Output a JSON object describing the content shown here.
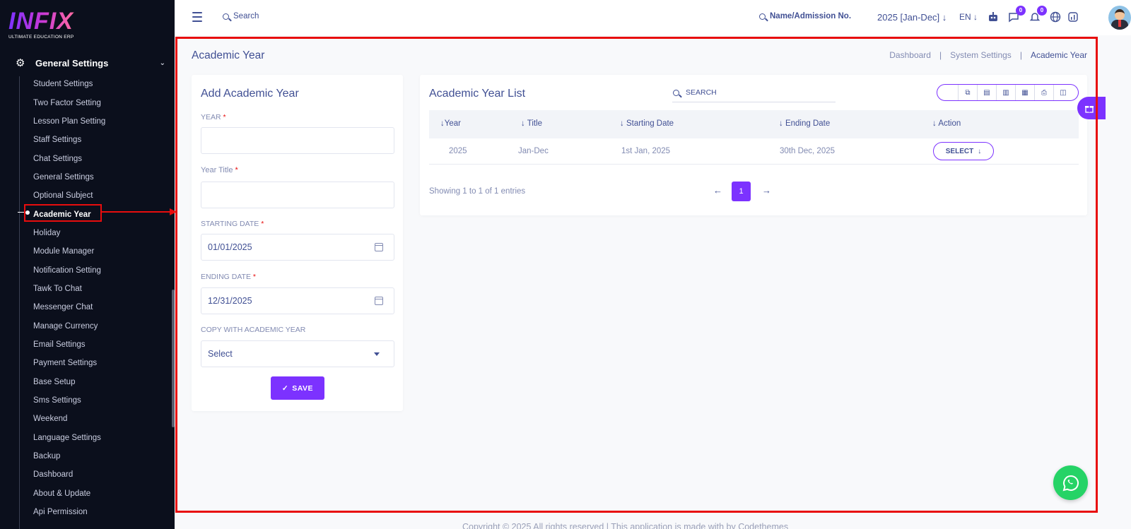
{
  "sidebar": {
    "logo": "INFIX",
    "logo_sub": "ULTIMATE EDUCATION ERP",
    "section_title": "General Settings",
    "items": [
      {
        "label": "Student Settings"
      },
      {
        "label": "Two Factor Setting"
      },
      {
        "label": "Lesson Plan Setting"
      },
      {
        "label": "Staff Settings"
      },
      {
        "label": "Chat Settings"
      },
      {
        "label": "General Settings"
      },
      {
        "label": "Optional Subject"
      },
      {
        "label": "Academic Year"
      },
      {
        "label": "Holiday"
      },
      {
        "label": "Module Manager"
      },
      {
        "label": "Notification Setting"
      },
      {
        "label": "Tawk To Chat"
      },
      {
        "label": "Messenger Chat"
      },
      {
        "label": "Manage Currency"
      },
      {
        "label": "Email Settings"
      },
      {
        "label": "Payment Settings"
      },
      {
        "label": "Base Setup"
      },
      {
        "label": "Sms Settings"
      },
      {
        "label": "Weekend"
      },
      {
        "label": "Language Settings"
      },
      {
        "label": "Backup"
      },
      {
        "label": "Dashboard"
      },
      {
        "label": "About & Update"
      },
      {
        "label": "Api Permission"
      }
    ],
    "active_item": "Academic Year"
  },
  "topbar": {
    "search_label": "Search",
    "name_search_label": "Name/Admission No.",
    "session": "2025 [Jan-Dec]",
    "language": "EN",
    "chat_badge": "0",
    "notification_badge": "0"
  },
  "page": {
    "title": "Academic Year",
    "breadcrumb": [
      "Dashboard",
      "System Settings",
      "Academic Year"
    ]
  },
  "form": {
    "title": "Add Academic Year",
    "year_label": "YEAR",
    "year_value": "",
    "year_title_label": "Year Title",
    "year_title_value": "",
    "starting_date_label": "STARTING DATE",
    "starting_date_value": "01/01/2025",
    "ending_date_label": "ENDING DATE",
    "ending_date_value": "12/31/2025",
    "copy_label": "COPY WITH ACADEMIC YEAR",
    "copy_value": "Select",
    "required_mark": "*",
    "save_label": "SAVE"
  },
  "list": {
    "title": "Academic Year List",
    "search_placeholder": "SEARCH",
    "columns": [
      "Year",
      "Title",
      "Starting Date",
      "Ending Date",
      "Action"
    ],
    "rows": [
      {
        "year": "2025",
        "title": "Jan-Dec",
        "starting_date": "1st Jan, 2025",
        "ending_date": "30th Dec, 2025",
        "action": "SELECT"
      }
    ],
    "showing": "Showing 1 to 1 of 1 entries",
    "current_page": "1"
  },
  "footer": {
    "text": "Copyright © 2025 All rights reserved | This application is made with by Codethemes"
  },
  "colors": {
    "accent": "#7c32ff",
    "sidebar_bg": "#0b0f1c",
    "text": "#415094",
    "highlight": "#e80d0d",
    "whatsapp": "#25d366"
  }
}
